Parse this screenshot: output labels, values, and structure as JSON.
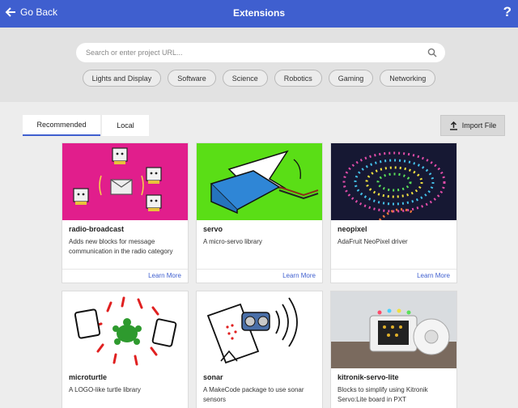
{
  "header": {
    "back_label": "Go Back",
    "title": "Extensions",
    "help_label": "?"
  },
  "search": {
    "placeholder": "Search or enter project URL...",
    "value": ""
  },
  "categories": [
    "Lights and Display",
    "Software",
    "Science",
    "Robotics",
    "Gaming",
    "Networking"
  ],
  "tabs": {
    "recommended": "Recommended",
    "local": "Local"
  },
  "import_label": "Import File",
  "cards": [
    {
      "name": "radio-broadcast",
      "description": "Adds new blocks for message communication in the radio category",
      "link": "Learn More"
    },
    {
      "name": "servo",
      "description": "A micro-servo library",
      "link": "Learn More"
    },
    {
      "name": "neopixel",
      "description": "AdaFruit NeoPixel driver",
      "link": "Learn More"
    },
    {
      "name": "microturtle",
      "description": "A LOGO-like turtle library",
      "link": ""
    },
    {
      "name": "sonar",
      "description": "A MakeCode package to use sonar sensors",
      "link": ""
    },
    {
      "name": "kitronik-servo-lite",
      "description": "Blocks to simplify using Kitronik Servo:Lite board in PXT",
      "link": ""
    }
  ],
  "colors": {
    "header": "#3f5fcf",
    "accent": "#3f5fcf",
    "radio_bg": "#e11e8c",
    "servo_bg": "#5ade16"
  }
}
